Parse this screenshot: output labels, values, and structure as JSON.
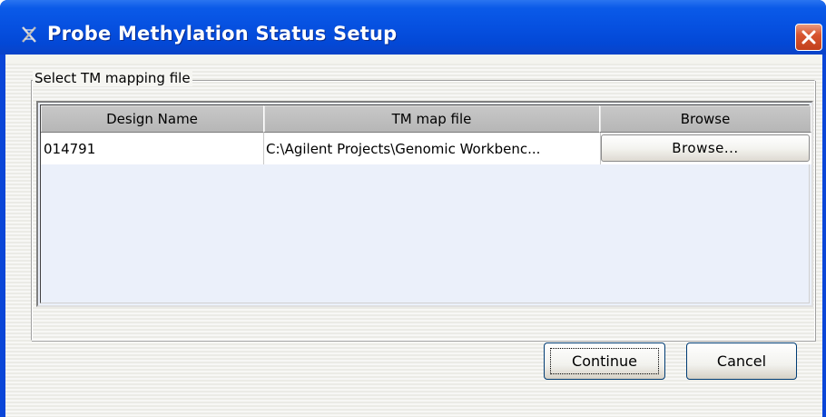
{
  "window": {
    "title": "Probe Methylation Status Setup",
    "title_icon": "helix-icon",
    "close_icon": "close-icon"
  },
  "group": {
    "label": "Select TM mapping file"
  },
  "table": {
    "columns": [
      "Design Name",
      "TM map file",
      "Browse"
    ],
    "rows": [
      {
        "design_name": "014791",
        "tm_map_file": "C:\\Agilent Projects\\Genomic Workbenc...",
        "browse_label": "Browse..."
      }
    ]
  },
  "buttons": {
    "continue_label": "Continue",
    "cancel_label": "Cancel"
  },
  "colors": {
    "titlebar": "#0650e0",
    "close_button": "#d8552f",
    "table_background": "#ebf0fa"
  }
}
